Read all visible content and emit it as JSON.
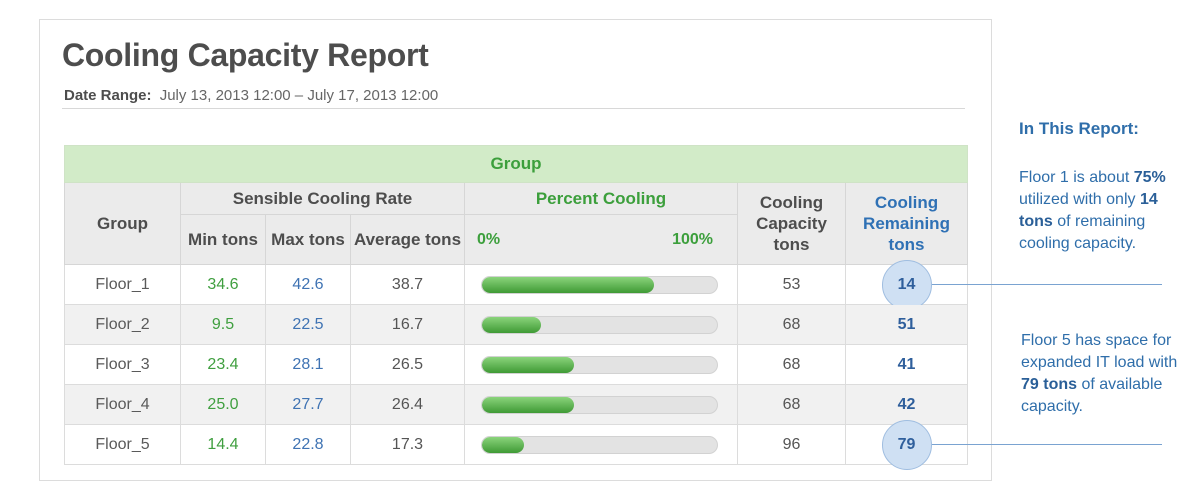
{
  "report": {
    "title": "Cooling Capacity Report",
    "date_range_label": "Date Range:",
    "date_range_value": "July 13, 2013 12:00 – July 17, 2013 12:00"
  },
  "table": {
    "banner": "Group",
    "headers": {
      "group": "Group",
      "sensible": "Sensible Cooling Rate",
      "min": "Min tons",
      "max": "Max tons",
      "avg": "Average tons",
      "percent": "Percent Cooling",
      "pct_min": "0%",
      "pct_max": "100%",
      "capacity": "Cooling Capacity tons",
      "remaining": "Cooling Remaining tons"
    },
    "rows": [
      {
        "group": "Floor_1",
        "min": "34.6",
        "max": "42.6",
        "avg": "38.7",
        "percent": 73,
        "capacity": "53",
        "remaining": "14",
        "highlight": true
      },
      {
        "group": "Floor_2",
        "min": "9.5",
        "max": "22.5",
        "avg": "16.7",
        "percent": 25,
        "capacity": "68",
        "remaining": "51",
        "highlight": false
      },
      {
        "group": "Floor_3",
        "min": "23.4",
        "max": "28.1",
        "avg": "26.5",
        "percent": 39,
        "capacity": "68",
        "remaining": "41",
        "highlight": false
      },
      {
        "group": "Floor_4",
        "min": "25.0",
        "max": "27.7",
        "avg": "26.4",
        "percent": 39,
        "capacity": "68",
        "remaining": "42",
        "highlight": false
      },
      {
        "group": "Floor_5",
        "min": "14.4",
        "max": "22.8",
        "avg": "17.3",
        "percent": 18,
        "capacity": "96",
        "remaining": "79",
        "highlight": true
      }
    ]
  },
  "sidebar": {
    "heading": "In This Report:",
    "note1": {
      "a": "Floor 1 is about ",
      "b": "75%",
      "c": " utilized with only ",
      "d": "14 tons",
      "e": " of remaining cooling capacity."
    },
    "note2": {
      "a": "Floor 5 has space for expanded IT load with ",
      "b": "79 tons",
      "c": " of available capacity."
    }
  },
  "colors": {
    "green": "#3c9f3c",
    "blue": "#2f71b5",
    "banner_bg": "#d2ebc8",
    "highlight_circle": "#cfe0f3"
  }
}
